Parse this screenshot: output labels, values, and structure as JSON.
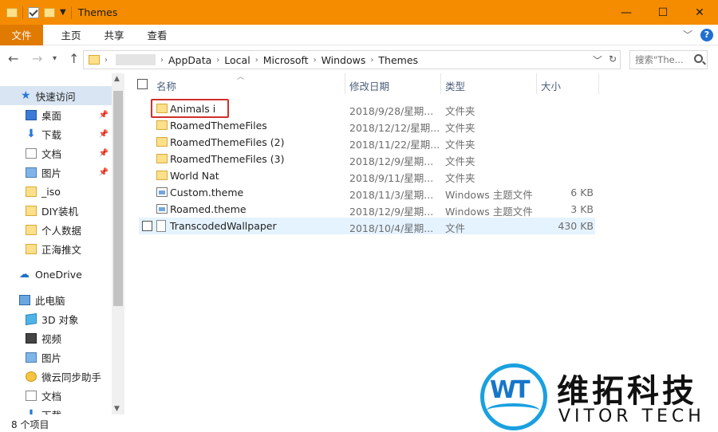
{
  "window": {
    "title": "Themes",
    "buttons": {
      "minimize": "—",
      "maximize": "☐",
      "close": "✕"
    }
  },
  "ribbon": {
    "tabs": [
      "文件",
      "主页",
      "共享",
      "查看"
    ],
    "help": "?"
  },
  "address": {
    "crumbs": [
      "AppData",
      "Local",
      "Microsoft",
      "Windows",
      "Themes"
    ],
    "search_placeholder": "搜索\"The..."
  },
  "sidebar": {
    "items": [
      {
        "label": "快速访问",
        "icon": "star-icon",
        "pinned": false
      },
      {
        "label": "桌面",
        "icon": "desktop-icon",
        "pinned": true
      },
      {
        "label": "下载",
        "icon": "download-icon",
        "pinned": true
      },
      {
        "label": "文档",
        "icon": "document-icon",
        "pinned": true
      },
      {
        "label": "图片",
        "icon": "picture-icon",
        "pinned": true
      },
      {
        "label": "_iso",
        "icon": "folder-icon",
        "pinned": false
      },
      {
        "label": "DIY装机",
        "icon": "folder-icon",
        "pinned": false
      },
      {
        "label": "个人数据",
        "icon": "folder-icon",
        "pinned": false
      },
      {
        "label": "正海推文",
        "icon": "folder-icon",
        "pinned": false
      },
      {
        "label": "OneDrive",
        "icon": "cloud-icon",
        "pinned": false
      },
      {
        "label": "此电脑",
        "icon": "computer-icon",
        "pinned": false
      },
      {
        "label": "3D 对象",
        "icon": "3d-objects-icon",
        "pinned": false
      },
      {
        "label": "视频",
        "icon": "video-icon",
        "pinned": false
      },
      {
        "label": "图片",
        "icon": "picture-icon",
        "pinned": false
      },
      {
        "label": "微云同步助手",
        "icon": "weiyun-icon",
        "pinned": false
      },
      {
        "label": "文档",
        "icon": "document-icon",
        "pinned": false
      },
      {
        "label": "下载",
        "icon": "download-icon",
        "pinned": false
      }
    ]
  },
  "columns": {
    "name": "名称",
    "date": "修改日期",
    "type": "类型",
    "size": "大小"
  },
  "files": [
    {
      "name": "Animals i",
      "date": "2018/9/28/星期...",
      "type": "文件夹",
      "size": "",
      "kind": "folder"
    },
    {
      "name": "RoamedThemeFiles",
      "date": "2018/12/12/星期...",
      "type": "文件夹",
      "size": "",
      "kind": "folder"
    },
    {
      "name": "RoamedThemeFiles (2)",
      "date": "2018/11/22/星期...",
      "type": "文件夹",
      "size": "",
      "kind": "folder"
    },
    {
      "name": "RoamedThemeFiles (3)",
      "date": "2018/12/9/星期...",
      "type": "文件夹",
      "size": "",
      "kind": "folder"
    },
    {
      "name": "World Nat",
      "date": "2018/9/11/星期...",
      "type": "文件夹",
      "size": "",
      "kind": "folder"
    },
    {
      "name": "Custom.theme",
      "date": "2018/11/3/星期...",
      "type": "Windows 主题文件",
      "size": "6 KB",
      "kind": "theme"
    },
    {
      "name": "Roamed.theme",
      "date": "2018/12/9/星期...",
      "type": "Windows 主题文件",
      "size": "3 KB",
      "kind": "theme"
    },
    {
      "name": "TranscodedWallpaper",
      "date": "2018/10/4/星期...",
      "type": "文件",
      "size": "430 KB",
      "kind": "file"
    }
  ],
  "status": {
    "count": "8 个项目"
  },
  "watermark": {
    "cn": "维拓科技",
    "en": "VITOR TECH"
  }
}
